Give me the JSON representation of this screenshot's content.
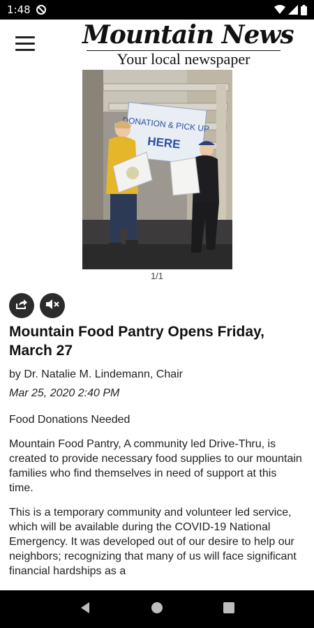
{
  "status_bar": {
    "time": "1:48"
  },
  "header": {
    "masthead_title": "Mountain News",
    "masthead_subtitle": "Your local newspaper"
  },
  "gallery": {
    "counter": "1/1",
    "photo_sign_text": [
      "DONATION & PICK UP",
      "HERE"
    ]
  },
  "article": {
    "title": "Mountain Food Pantry Opens Friday, March 27",
    "byline": "by Dr. Natalie M. Lindemann, Chair",
    "date": "Mar 25, 2020 2:40 PM",
    "paragraphs": [
      "Food Donations Needed",
      "Mountain Food Pantry, A community led Drive-Thru, is created to provide necessary food supplies to our mountain families who find themselves in need of support at this time.",
      "This is a temporary community and volunteer led service, which will be available during the COVID-19 National Emergency. It was developed out of our desire to help our neighbors; recognizing that many of us will face significant financial hardships as a"
    ]
  },
  "icons": {
    "share": "share-icon",
    "mute": "mute-icon",
    "menu": "hamburger-menu-icon"
  }
}
